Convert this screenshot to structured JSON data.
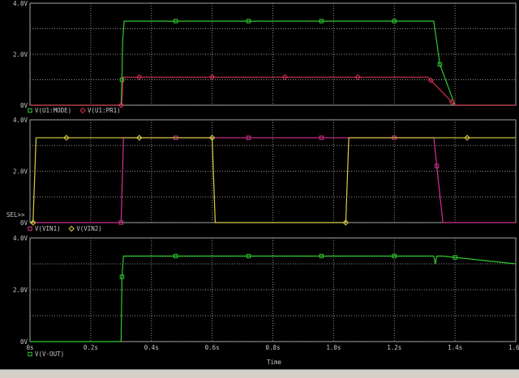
{
  "window": {
    "status_text": ""
  },
  "chart_data": [
    {
      "type": "line",
      "panel": "top",
      "ylim": [
        0,
        4.0
      ],
      "yticks": [
        {
          "v": 0,
          "label": "0V"
        },
        {
          "v": 2.0,
          "label": "2.0V"
        },
        {
          "v": 4.0,
          "label": "4.0V"
        }
      ],
      "legend": [
        {
          "marker": "square",
          "name": "V(U1:MODE)",
          "color": "#2ec82e"
        },
        {
          "marker": "diamond",
          "name": "V(U1:PR1)",
          "color": "#d03050"
        }
      ],
      "series": [
        {
          "name": "V(U1:MODE)",
          "color": "#2ec82e",
          "marker": "square",
          "x": [
            0,
            0.3,
            0.303,
            0.305,
            0.31,
            1.33,
            1.35,
            1.4,
            1.6
          ],
          "y": [
            0,
            0,
            1.0,
            2.5,
            3.3,
            3.3,
            1.6,
            0,
            0
          ],
          "markers_x": [
            0.303,
            0.48,
            0.72,
            0.96,
            1.2,
            1.35
          ]
        },
        {
          "name": "V(U1:PR1)",
          "color": "#d03050",
          "marker": "diamond",
          "x": [
            0,
            0.302,
            0.306,
            1.31,
            1.4,
            1.6
          ],
          "y": [
            0,
            0,
            1.1,
            1.1,
            0,
            0
          ],
          "markers_x": [
            0.3,
            0.36,
            0.6,
            0.84,
            1.08,
            1.32,
            1.39
          ]
        }
      ]
    },
    {
      "type": "line",
      "panel": "middle",
      "ylim": [
        0,
        4.0
      ],
      "yticks": [
        {
          "v": 0,
          "label": "0V"
        },
        {
          "v": 2.0,
          "label": "2.0V"
        },
        {
          "v": 4.0,
          "label": "4.0V"
        }
      ],
      "sel_label": "SEL>>",
      "legend": [
        {
          "marker": "square",
          "name": "V(VIN1)",
          "color": "#d03090"
        },
        {
          "marker": "diamond",
          "name": "V(VIN2)",
          "color": "#d8d040"
        }
      ],
      "series": [
        {
          "name": "V(VIN1)",
          "color": "#d03090",
          "marker": "square",
          "x": [
            0,
            0.3,
            0.308,
            1.33,
            1.36,
            1.6
          ],
          "y": [
            0,
            0,
            3.3,
            3.3,
            0,
            0
          ],
          "markers_x": [
            0.3,
            0.48,
            0.72,
            0.96,
            1.2,
            1.34
          ]
        },
        {
          "name": "V(VIN2)",
          "color": "#d8d040",
          "marker": "diamond",
          "x": [
            0,
            0.01,
            0.02,
            0.6,
            0.61,
            1.04,
            1.05,
            1.6
          ],
          "y": [
            0,
            0,
            3.3,
            3.3,
            0,
            0,
            3.3,
            3.3
          ],
          "markers_x": [
            0.01,
            0.12,
            0.36,
            0.6,
            1.04,
            1.44
          ]
        }
      ]
    },
    {
      "type": "line",
      "panel": "bottom",
      "ylim": [
        0,
        4.0
      ],
      "yticks": [
        {
          "v": 0,
          "label": "0V"
        },
        {
          "v": 2.0,
          "label": "2.0V"
        },
        {
          "v": 4.0,
          "label": "4.0V"
        }
      ],
      "legend": [
        {
          "marker": "square",
          "name": "V(V-OUT)",
          "color": "#2ec82e"
        }
      ],
      "series": [
        {
          "name": "V(V-OUT)",
          "color": "#2ec82e",
          "marker": "square",
          "x": [
            0,
            0.3,
            0.303,
            0.308,
            1.33,
            1.335,
            1.34,
            1.36,
            1.6
          ],
          "y": [
            0,
            0,
            2.5,
            3.3,
            3.3,
            3.0,
            3.3,
            3.3,
            3.0
          ],
          "markers_x": [
            0.303,
            0.48,
            0.72,
            0.96,
            1.2,
            1.4
          ]
        }
      ]
    }
  ],
  "xaxis": {
    "label": "Time",
    "xlim": [
      0,
      1.6
    ],
    "ticks": [
      {
        "v": 0,
        "label": "0s"
      },
      {
        "v": 0.2,
        "label": "0.2s"
      },
      {
        "v": 0.4,
        "label": "0.4s"
      },
      {
        "v": 0.6,
        "label": "0.6s"
      },
      {
        "v": 0.8,
        "label": "0.8s"
      },
      {
        "v": 1.0,
        "label": "1.0s"
      },
      {
        "v": 1.2,
        "label": "1.2s"
      },
      {
        "v": 1.4,
        "label": "1.4s"
      },
      {
        "v": 1.6,
        "label": "1.6s"
      }
    ]
  }
}
